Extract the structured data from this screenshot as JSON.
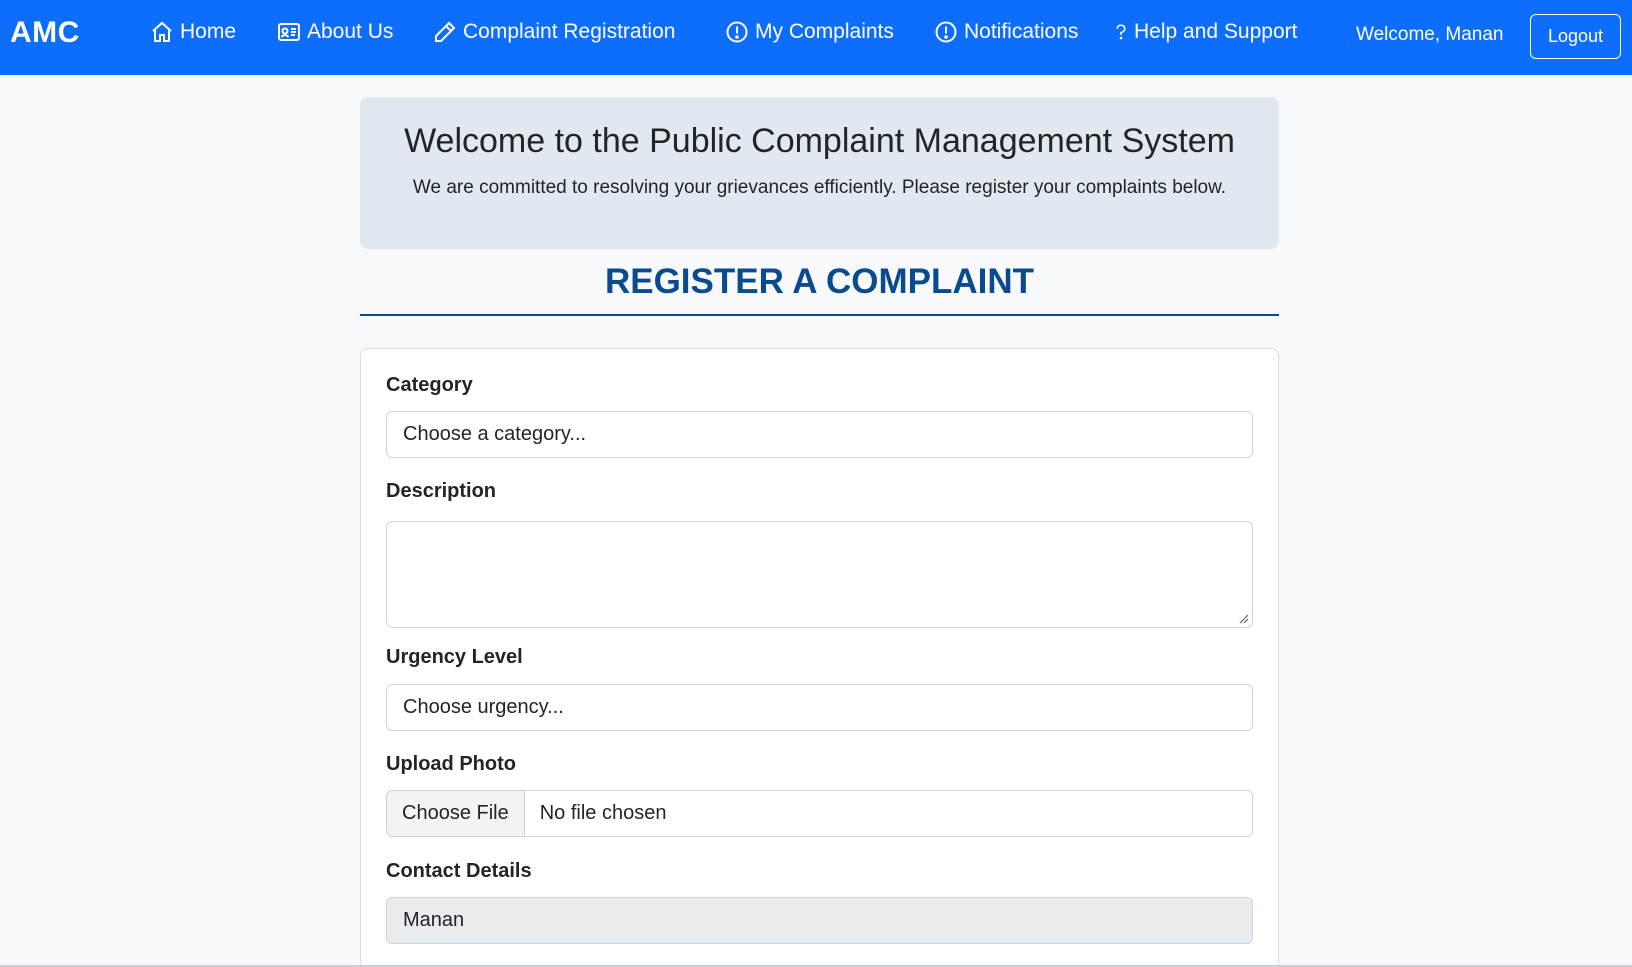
{
  "navbar": {
    "brand": "AMC",
    "items": [
      {
        "label": "Home",
        "icon": "home-icon"
      },
      {
        "label": "About Us",
        "icon": "id-card-icon"
      },
      {
        "label": "Complaint Registration",
        "icon": "pencil-icon"
      },
      {
        "label": "My Complaints",
        "icon": "exclamation-circle-icon"
      },
      {
        "label": "Notifications",
        "icon": "exclamation-circle-icon"
      },
      {
        "label": "Help and Support",
        "icon": "question-icon"
      }
    ],
    "welcome": "Welcome, Manan",
    "logout_label": "Logout"
  },
  "hero": {
    "title": "Welcome to the Public Complaint Management System",
    "subtitle": "We are committed to resolving your grievances efficiently. Please register your complaints below."
  },
  "form": {
    "heading": "REGISTER A COMPLAINT",
    "category": {
      "label": "Category",
      "value": "Choose a category..."
    },
    "description": {
      "label": "Description",
      "value": ""
    },
    "urgency": {
      "label": "Urgency Level",
      "value": "Choose urgency..."
    },
    "photo": {
      "label": "Upload Photo",
      "button": "Choose File",
      "status": "No file chosen"
    },
    "contact": {
      "label": "Contact Details",
      "value": "Manan"
    }
  },
  "colors": {
    "navbar": "#0d6efd",
    "heading": "#0a4a8f",
    "hero_bg": "#e2e8f0"
  }
}
